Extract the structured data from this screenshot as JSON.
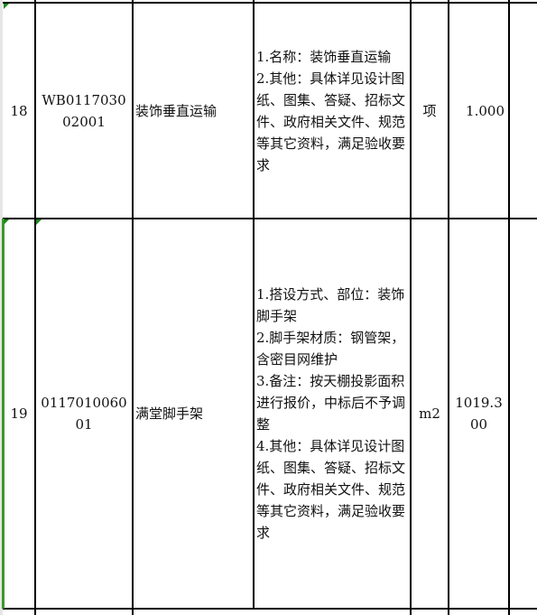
{
  "rows": [
    {
      "no": "18",
      "code": "WB011703002001",
      "name": "装饰垂直运输",
      "desc": [
        "1.名称：装饰垂直运输",
        "2.其他：具体详见设计图纸、图集、答疑、招标文件、政府相关文件、规范等其它资料，满足验收要求"
      ],
      "unit": "项",
      "qty": "1.000"
    },
    {
      "no": "19",
      "code": "011701006001",
      "name": "满堂脚手架",
      "desc": [
        "1.搭设方式、部位：装饰脚手架",
        "2.脚手架材质：钢管架，含密目网维护",
        "3.备注：按天棚投影面积进行报价，中标后不予调整",
        "4.其他：具体详见设计图纸、图集、答疑、招标文件、政府相关文件、规范等其它资料，满足验收要求"
      ],
      "unit": "m2",
      "qty": "1019.300"
    }
  ],
  "colors": {
    "selection": "#3a9a2a",
    "grid": "#000000"
  }
}
